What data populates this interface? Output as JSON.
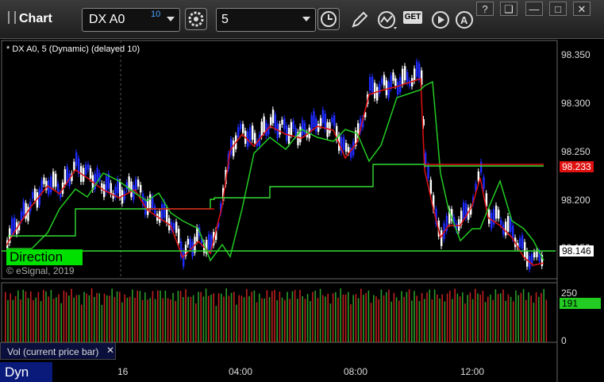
{
  "window": {
    "title": "Chart",
    "buttons": {
      "help": "?",
      "restore": "❑",
      "minimize": "—",
      "maximize": "□",
      "close": "✕"
    }
  },
  "toolbar": {
    "symbol_value": "DX A0",
    "symbol_delay_badge": "10",
    "interval_value": "5",
    "icons": [
      "settings-gear-icon",
      "clock-icon",
      "pencil-draw-icon",
      "study-icon",
      "get-icon",
      "play-icon",
      "alert-icon"
    ],
    "get_label": "GET"
  },
  "chart": {
    "header": "* DX A0, 5 (Dynamic) (delayed 10)",
    "copyright": "© eSignal, 2019",
    "direction_label": "Direction",
    "colors": {
      "up": "#1e2bff",
      "down": "#ffffff",
      "ma_red": "#e01010",
      "ma_green": "#22cc22",
      "ma_line": "#33dd33"
    },
    "price_ticks": [
      "98.350",
      "98.300",
      "98.250",
      "98.200",
      "98.150"
    ],
    "last_price": "98.146",
    "red_tag": "98.233",
    "volume_ticks": [
      "250",
      "0"
    ],
    "volume_tag": "191",
    "time_labels": [
      "16",
      "04:00",
      "08:00",
      "12:00"
    ]
  },
  "volume_panel": {
    "label": "Vol (current price bar)",
    "close": "✕"
  },
  "footer": {
    "mode_label": "Dyn"
  }
}
